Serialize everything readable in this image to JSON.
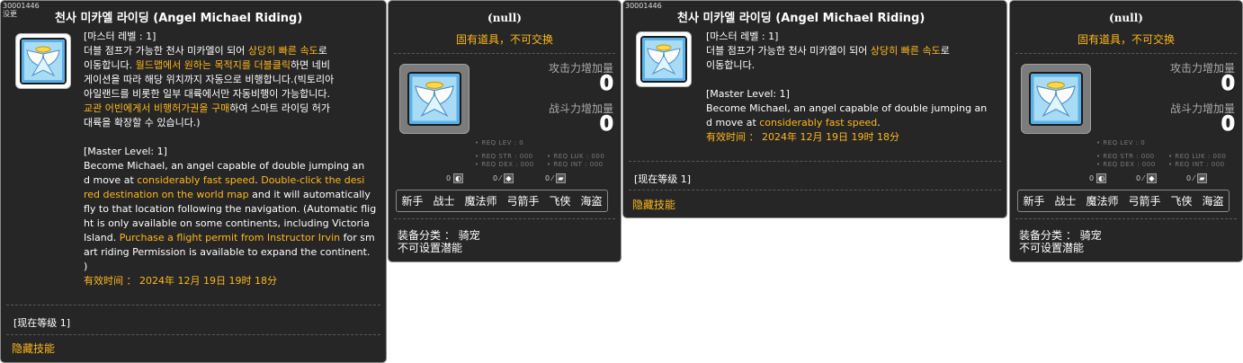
{
  "item_id": "30001446",
  "icon_name": "angel-wings-icon",
  "detail": {
    "sub_label": "没更",
    "title": "천사 미카엘 라이딩 (Angel Michael Riding)",
    "kr_master_level": "[마스터 레벨 : 1]",
    "kr_line1_a": "더블 점프가 가능한 천사 미카엘이 되어 ",
    "kr_line1_hl": "상당히 빠른 속도",
    "kr_line1_b": "로",
    "kr_line2_a": "이동합니다. ",
    "kr_line2_hl": "월드맵에서 원하는 목적지를 더블클릭",
    "kr_line2_b": "하면 네비",
    "kr_line3": "게이션을 따라 해당 위치까지 자동으로 비행합니다.(빅토리아",
    "kr_line4": "아일랜드를 비롯한 일부 대륙에서만 자동비행이 가능합니다.",
    "kr_line5_hl": "교관 어빈에게서 비행허가권을 구매",
    "kr_line5_b": "하여 스마트 라이딩 허가",
    "kr_line6": "대륙을 확장할 수 있습니다.)",
    "en_master_level": "[Master Level: 1]",
    "en_line1": "Become Michael, an angel capable of double jumping an",
    "en_line2_a": "d move at ",
    "en_line2_hl": "considerably fast speed",
    "en_line2_b": ". ",
    "en_line2_hl2": "Double-click the desi",
    "en_line3_hl": "red destination on the world map",
    "en_line3_b": " and it will automatically",
    "en_line4": "fly to that location following the navigation. (Automatic flig",
    "en_line5": "ht is only available on some continents, including Victoria",
    "en_line6_a": "Island. ",
    "en_line6_hl": "Purchase a flight permit from Instructor Irvin",
    "en_line6_b": " for sm",
    "en_line7": "art riding Permission is available to expand the continent.",
    "en_line8": ")",
    "expiry": "有效时间 ： 2024年 12月 19日 19时 18分",
    "current_level": "[现在等级 1]",
    "hidden_skill": "隐藏技能"
  },
  "item_card": {
    "title": "(null)",
    "untradeable": "固有道具，不可交换",
    "attack_label": "攻击力增加量",
    "attack_value": "0",
    "combat_label": "战斗力增加量",
    "combat_value": "0",
    "req_lev": "• REQ LEV :    0",
    "req_str": "• REQ STR : 000",
    "req_luk": "• REQ LUK : 000",
    "req_dex": "• REQ DEX : 000",
    "req_int": "• REQ INT : 000",
    "elem1": "0",
    "elem2": "0 ⁄",
    "elem3": "0 ⁄",
    "jobs": [
      "新手",
      "战士",
      "魔法师",
      "弓箭手",
      "飞侠",
      "海盗"
    ],
    "equip_category": "装备分类 ： 骑宠",
    "no_potential": "不可设置潜能"
  },
  "summary": {
    "title": "천사 미카엘 라이딩 (Angel Michael Riding)",
    "kr_master_level": "[마스터 레벨 : 1]",
    "kr_line1_a": "더블 점프가 가능한 천사 미카엘이 되어 ",
    "kr_line1_hl": "상당히 빠른 속도",
    "kr_line1_b": "로",
    "kr_line2": "이동합니다.",
    "en_master_level": "[Master Level: 1]",
    "en_line1": "Become Michael, an angel capable of double jumping an",
    "en_line2_a": "d move at ",
    "en_line2_hl": "considerably fast speed",
    "en_line2_b": ".",
    "expiry": "有效时间 ： 2024年 12月 19日 19时 18分",
    "current_level": "[现在等级 1]",
    "hidden_skill": "隐藏技能"
  }
}
